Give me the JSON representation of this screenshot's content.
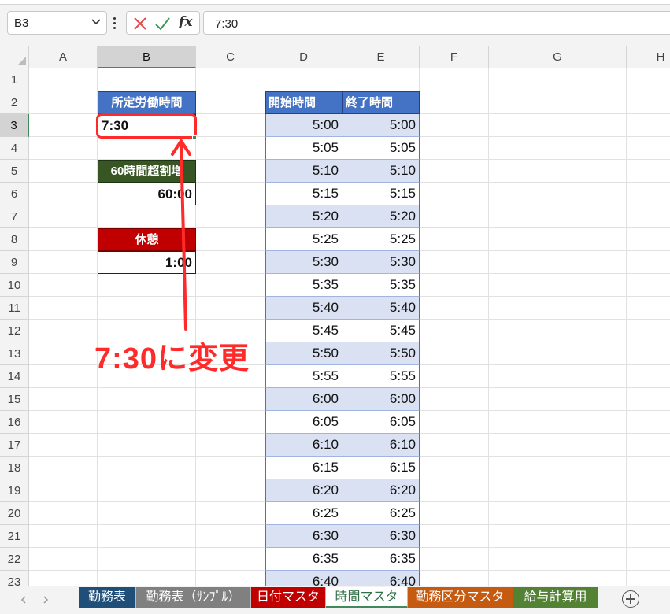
{
  "formula_bar": {
    "name_box": "B3",
    "formula": "7:30",
    "fx_label": "fx"
  },
  "columns": [
    "A",
    "B",
    "C",
    "D",
    "E",
    "F",
    "G",
    "H"
  ],
  "rows": [
    "1",
    "2",
    "3",
    "4",
    "5",
    "6",
    "7",
    "8",
    "9",
    "10",
    "11",
    "12",
    "13",
    "14",
    "15",
    "16",
    "17",
    "18",
    "19",
    "20",
    "21",
    "22",
    "23"
  ],
  "cells": {
    "b2": "所定労働時間",
    "b3": "7:30",
    "b5": "60時間超割増",
    "b6": "60:00",
    "b8": "休憩",
    "b9": "1:00",
    "d2": "開始時間",
    "e2": "終了時間"
  },
  "time_table": [
    [
      "5:00",
      "5:00"
    ],
    [
      "5:05",
      "5:05"
    ],
    [
      "5:10",
      "5:10"
    ],
    [
      "5:15",
      "5:15"
    ],
    [
      "5:20",
      "5:20"
    ],
    [
      "5:25",
      "5:25"
    ],
    [
      "5:30",
      "5:30"
    ],
    [
      "5:35",
      "5:35"
    ],
    [
      "5:40",
      "5:40"
    ],
    [
      "5:45",
      "5:45"
    ],
    [
      "5:50",
      "5:50"
    ],
    [
      "5:55",
      "5:55"
    ],
    [
      "6:00",
      "6:00"
    ],
    [
      "6:05",
      "6:05"
    ],
    [
      "6:10",
      "6:10"
    ],
    [
      "6:15",
      "6:15"
    ],
    [
      "6:20",
      "6:20"
    ],
    [
      "6:25",
      "6:25"
    ],
    [
      "6:30",
      "6:30"
    ],
    [
      "6:35",
      "6:35"
    ],
    [
      "6:40",
      "6:40"
    ]
  ],
  "annotation": {
    "text": "7:30に変更",
    "color": "#ff2a2a"
  },
  "sheet_tabs": [
    {
      "label": "勤務表",
      "color": "#1f4e79"
    },
    {
      "label": "勤務表（ｻﾝﾌﾟﾙ）",
      "color": "#808080"
    },
    {
      "label": "日付マスタ",
      "color": "#c00000"
    },
    {
      "label": "時間マスタ",
      "color": "#ffffff",
      "active": true
    },
    {
      "label": "勤務区分マスタ",
      "color": "#c55a11"
    },
    {
      "label": "給与計算用",
      "color": "#548235"
    }
  ],
  "colors": {
    "header_blue": "#4472c4",
    "header_green": "#375623",
    "header_red": "#c00000",
    "band": "#d9e1f2",
    "selection": "#3e8a5b"
  }
}
